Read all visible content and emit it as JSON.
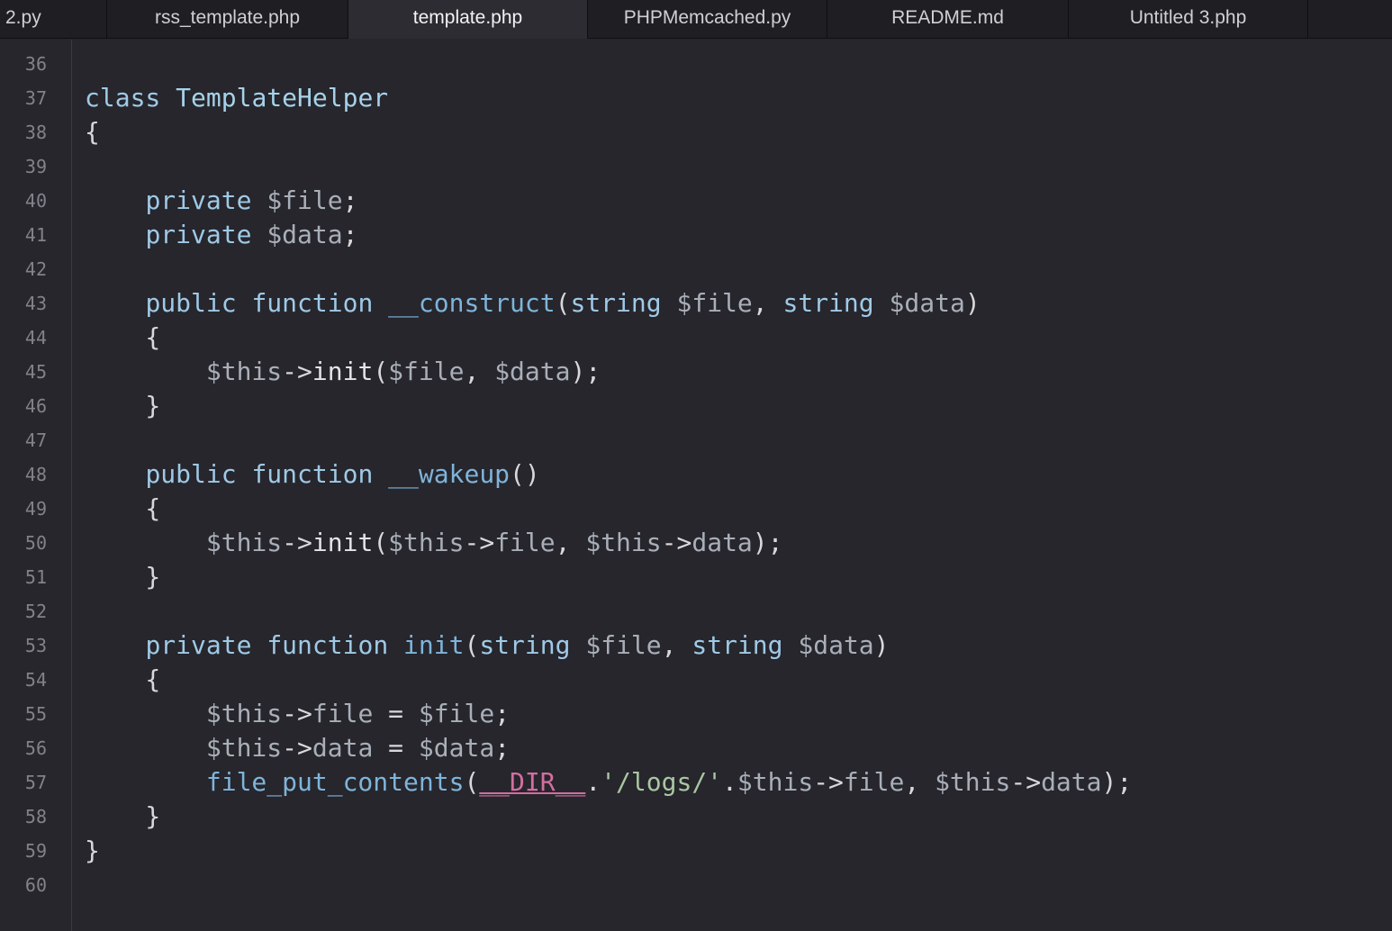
{
  "tabs": [
    {
      "label": "2.py",
      "active": false
    },
    {
      "label": "rss_template.php",
      "active": false
    },
    {
      "label": "template.php",
      "active": true
    },
    {
      "label": "PHPMemcached.py",
      "active": false
    },
    {
      "label": "README.md",
      "active": false
    },
    {
      "label": "Untitled 3.php",
      "active": false
    }
  ],
  "line_numbers": [
    "36",
    "37",
    "38",
    "39",
    "40",
    "41",
    "42",
    "43",
    "44",
    "45",
    "46",
    "47",
    "48",
    "49",
    "50",
    "51",
    "52",
    "53",
    "54",
    "55",
    "56",
    "57",
    "58",
    "59",
    "60"
  ],
  "code_lines": [
    [],
    [
      {
        "t": "class",
        "c": "kw"
      },
      {
        "t": " ",
        "c": "punc"
      },
      {
        "t": "TemplateHelper",
        "c": "cls"
      }
    ],
    [
      {
        "t": "{",
        "c": "punc"
      }
    ],
    [],
    [
      {
        "t": "    ",
        "c": "punc"
      },
      {
        "t": "private",
        "c": "kw"
      },
      {
        "t": " ",
        "c": "punc"
      },
      {
        "t": "$file",
        "c": "var"
      },
      {
        "t": ";",
        "c": "punc"
      }
    ],
    [
      {
        "t": "    ",
        "c": "punc"
      },
      {
        "t": "private",
        "c": "kw"
      },
      {
        "t": " ",
        "c": "punc"
      },
      {
        "t": "$data",
        "c": "var"
      },
      {
        "t": ";",
        "c": "punc"
      }
    ],
    [],
    [
      {
        "t": "    ",
        "c": "punc"
      },
      {
        "t": "public",
        "c": "kw"
      },
      {
        "t": " ",
        "c": "punc"
      },
      {
        "t": "function",
        "c": "kw"
      },
      {
        "t": " ",
        "c": "punc"
      },
      {
        "t": "__construct",
        "c": "fn"
      },
      {
        "t": "(",
        "c": "punc"
      },
      {
        "t": "string",
        "c": "typ"
      },
      {
        "t": " ",
        "c": "punc"
      },
      {
        "t": "$file",
        "c": "var"
      },
      {
        "t": ", ",
        "c": "punc"
      },
      {
        "t": "string",
        "c": "typ"
      },
      {
        "t": " ",
        "c": "punc"
      },
      {
        "t": "$data",
        "c": "var"
      },
      {
        "t": ")",
        "c": "punc"
      }
    ],
    [
      {
        "t": "    {",
        "c": "punc"
      }
    ],
    [
      {
        "t": "        ",
        "c": "punc"
      },
      {
        "t": "$this",
        "c": "var"
      },
      {
        "t": "->",
        "c": "punc"
      },
      {
        "t": "init",
        "c": "call"
      },
      {
        "t": "(",
        "c": "punc"
      },
      {
        "t": "$file",
        "c": "var"
      },
      {
        "t": ", ",
        "c": "punc"
      },
      {
        "t": "$data",
        "c": "var"
      },
      {
        "t": ");",
        "c": "punc"
      }
    ],
    [
      {
        "t": "    }",
        "c": "punc"
      }
    ],
    [],
    [
      {
        "t": "    ",
        "c": "punc"
      },
      {
        "t": "public",
        "c": "kw"
      },
      {
        "t": " ",
        "c": "punc"
      },
      {
        "t": "function",
        "c": "kw"
      },
      {
        "t": " ",
        "c": "punc"
      },
      {
        "t": "__wakeup",
        "c": "fn"
      },
      {
        "t": "()",
        "c": "punc"
      }
    ],
    [
      {
        "t": "    {",
        "c": "punc"
      }
    ],
    [
      {
        "t": "        ",
        "c": "punc"
      },
      {
        "t": "$this",
        "c": "var"
      },
      {
        "t": "->",
        "c": "punc"
      },
      {
        "t": "init",
        "c": "call"
      },
      {
        "t": "(",
        "c": "punc"
      },
      {
        "t": "$this",
        "c": "var"
      },
      {
        "t": "->",
        "c": "punc"
      },
      {
        "t": "file",
        "c": "var"
      },
      {
        "t": ", ",
        "c": "punc"
      },
      {
        "t": "$this",
        "c": "var"
      },
      {
        "t": "->",
        "c": "punc"
      },
      {
        "t": "data",
        "c": "var"
      },
      {
        "t": ");",
        "c": "punc"
      }
    ],
    [
      {
        "t": "    }",
        "c": "punc"
      }
    ],
    [],
    [
      {
        "t": "    ",
        "c": "punc"
      },
      {
        "t": "private",
        "c": "kw"
      },
      {
        "t": " ",
        "c": "punc"
      },
      {
        "t": "function",
        "c": "kw"
      },
      {
        "t": " ",
        "c": "punc"
      },
      {
        "t": "init",
        "c": "fn"
      },
      {
        "t": "(",
        "c": "punc"
      },
      {
        "t": "string",
        "c": "typ"
      },
      {
        "t": " ",
        "c": "punc"
      },
      {
        "t": "$file",
        "c": "var"
      },
      {
        "t": ", ",
        "c": "punc"
      },
      {
        "t": "string",
        "c": "typ"
      },
      {
        "t": " ",
        "c": "punc"
      },
      {
        "t": "$data",
        "c": "var"
      },
      {
        "t": ")",
        "c": "punc"
      }
    ],
    [
      {
        "t": "    {",
        "c": "punc"
      }
    ],
    [
      {
        "t": "        ",
        "c": "punc"
      },
      {
        "t": "$this",
        "c": "var"
      },
      {
        "t": "->",
        "c": "punc"
      },
      {
        "t": "file",
        "c": "var"
      },
      {
        "t": " = ",
        "c": "punc"
      },
      {
        "t": "$file",
        "c": "var"
      },
      {
        "t": ";",
        "c": "punc"
      }
    ],
    [
      {
        "t": "        ",
        "c": "punc"
      },
      {
        "t": "$this",
        "c": "var"
      },
      {
        "t": "->",
        "c": "punc"
      },
      {
        "t": "data",
        "c": "var"
      },
      {
        "t": " = ",
        "c": "punc"
      },
      {
        "t": "$data",
        "c": "var"
      },
      {
        "t": ";",
        "c": "punc"
      }
    ],
    [
      {
        "t": "        ",
        "c": "punc"
      },
      {
        "t": "file_put_contents",
        "c": "fn"
      },
      {
        "t": "(",
        "c": "punc"
      },
      {
        "t": "__DIR__",
        "c": "magic"
      },
      {
        "t": ".",
        "c": "punc"
      },
      {
        "t": "'/logs/'",
        "c": "str"
      },
      {
        "t": ".",
        "c": "punc"
      },
      {
        "t": "$this",
        "c": "var"
      },
      {
        "t": "->",
        "c": "punc"
      },
      {
        "t": "file",
        "c": "var"
      },
      {
        "t": ", ",
        "c": "punc"
      },
      {
        "t": "$this",
        "c": "var"
      },
      {
        "t": "->",
        "c": "punc"
      },
      {
        "t": "data",
        "c": "var"
      },
      {
        "t": ");",
        "c": "punc"
      }
    ],
    [
      {
        "t": "    }",
        "c": "punc"
      }
    ],
    [
      {
        "t": "}",
        "c": "punc"
      }
    ],
    []
  ]
}
